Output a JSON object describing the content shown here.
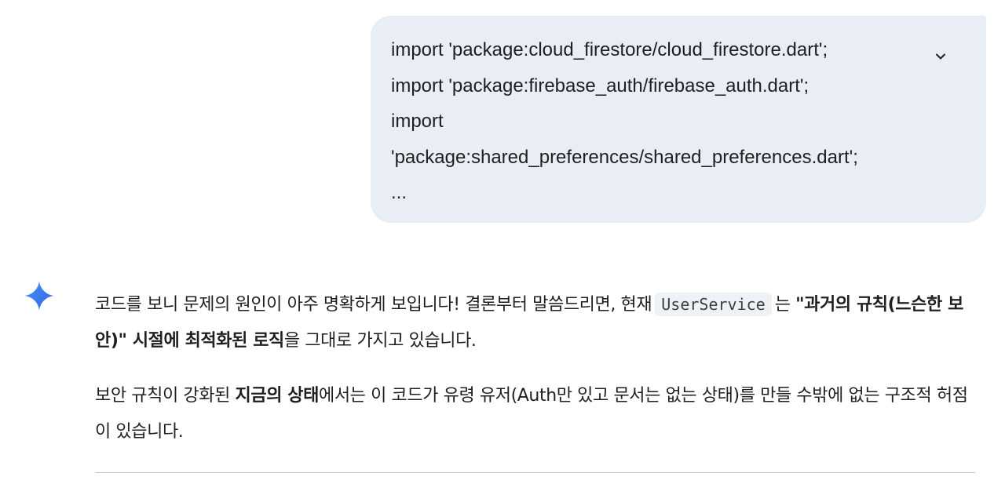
{
  "user_prompt": {
    "lines": [
      "import 'package:cloud_firestore/cloud_firestore.dart';",
      "import 'package:firebase_auth/firebase_auth.dart';",
      "import",
      "'package:shared_preferences/shared_preferences.dart';",
      "..."
    ],
    "expand_icon": "chevron-down-icon"
  },
  "assistant": {
    "logo_icon": "gemini-sparkle-icon",
    "paragraph1": {
      "text_a": "코드를 보니 문제의 원인이 아주 명확하게 보입니다! 결론부터 말씀드리면, 현재",
      "code": "UserService",
      "text_b": "는",
      "bold": "\"과거의 규칙(느슨한 보안)\" 시절에 최적화된 로직",
      "text_c": "을 그대로 가지고 있습니다."
    },
    "paragraph2": {
      "text_a": "보안 규칙이 강화된",
      "bold": "지금의 상태",
      "text_b": "에서는 이 코드가 유령 유저(Auth만 있고 문서는 없는 상태)를 만들 수밖에 없는 구조적 허점이 있습니다."
    }
  },
  "colors": {
    "bubble_bg": "#e9eef6",
    "text": "#1f1f1f",
    "code_bg": "#eef1f6",
    "divider": "#c4c7c5",
    "gemini_blue": "#4285f4"
  }
}
